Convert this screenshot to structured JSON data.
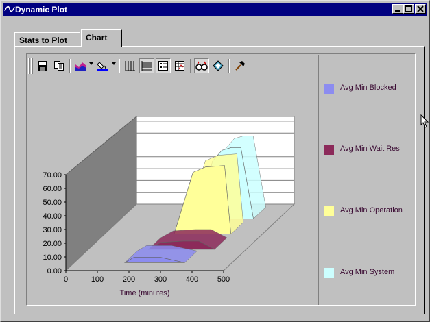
{
  "window": {
    "title": "Dynamic Plot",
    "controls": {
      "minimize": "minimize",
      "maximize": "maximize",
      "close": "close"
    }
  },
  "tabs": [
    {
      "label": "Stats to Plot",
      "active": false
    },
    {
      "label": "Chart",
      "active": true
    }
  ],
  "toolbar": {
    "icons": [
      "save-icon",
      "copy-icon",
      "chart-type-icon",
      "color-fill-icon",
      "vertical-grid-icon",
      "horizontal-grid-icon",
      "legend-icon",
      "data-table-icon",
      "3d-view-icon",
      "rotate-icon",
      "properties-icon"
    ]
  },
  "colors": {
    "blocked": "#8c8cf0",
    "wait_res": "#8c2a5a",
    "operation": "#ffff99",
    "system": "#ccffff",
    "wall_back": "#ffffff",
    "wall_side": "#808080",
    "floor": "#c0c0c0"
  },
  "chart_data": {
    "type": "area",
    "view": "3d",
    "xlabel": "Time (minutes)",
    "ylabel": "",
    "x_ticks": [
      "0",
      "100",
      "200",
      "300",
      "400",
      "500"
    ],
    "y_ticks": [
      "0.00",
      "10.00",
      "20.00",
      "30.00",
      "40.00",
      "50.00",
      "60.00",
      "70.00"
    ],
    "xlim": [
      0,
      500
    ],
    "ylim": [
      0,
      70
    ],
    "series": [
      {
        "name": "Avg Min Blocked",
        "x": [
          160,
          190,
          240,
          270,
          350
        ],
        "y": [
          0,
          4,
          4,
          4,
          0
        ]
      },
      {
        "name": "Avg Min Wait Res",
        "x": [
          190,
          230,
          300,
          350,
          400
        ],
        "y": [
          0,
          5,
          6,
          6,
          0
        ]
      },
      {
        "name": "Avg Min Operation",
        "x": [
          220,
          260,
          280,
          320,
          380,
          400
        ],
        "y": [
          0,
          30,
          45,
          49,
          50,
          0
        ]
      },
      {
        "name": "Avg Min System",
        "x": [
          250,
          290,
          320,
          350,
          380,
          420
        ],
        "y": [
          0,
          42,
          50,
          52,
          52,
          0
        ]
      }
    ],
    "legend_position": "right"
  },
  "legend": [
    {
      "label": "Avg Min Blocked"
    },
    {
      "label": "Avg Min Wait Res"
    },
    {
      "label": "Avg Min Operation"
    },
    {
      "label": "Avg Min System"
    }
  ]
}
